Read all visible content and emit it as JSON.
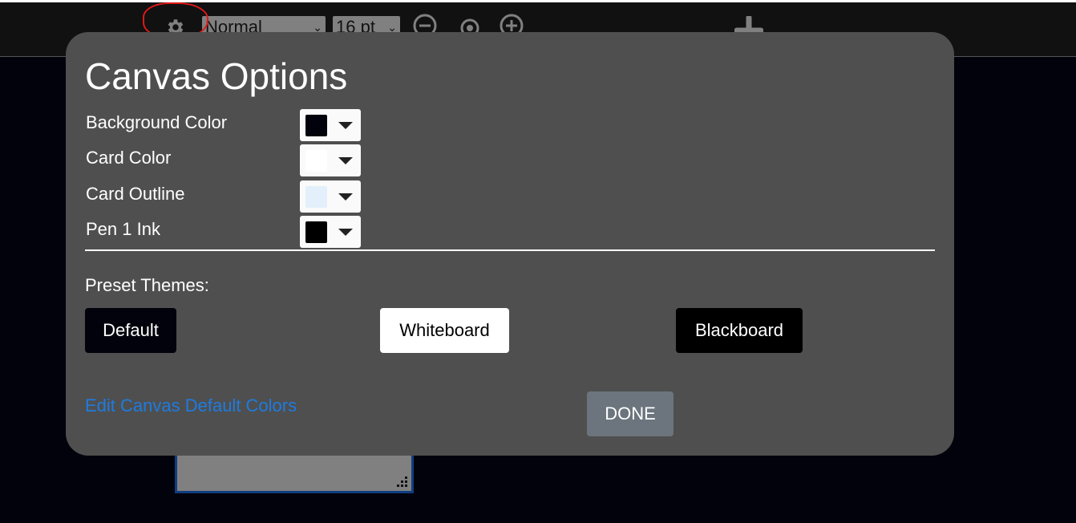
{
  "toolbar": {
    "style_select": {
      "value": "Normal"
    },
    "size_select": {
      "value": "16 pt"
    },
    "icons": [
      "gear-icon",
      "zoom-out-icon",
      "zoom-reset-icon",
      "zoom-in-icon",
      "add-card-icon"
    ],
    "annotation_color": "#e01818"
  },
  "modal": {
    "title": "Canvas Options",
    "color_rows": [
      {
        "label": "Background Color",
        "color": "#02020c"
      },
      {
        "label": "Card Color",
        "color": "#ffffff"
      },
      {
        "label": "Card Outline",
        "color": "#e3f0fb"
      },
      {
        "label": "Pen 1 Ink",
        "color": "#000000"
      }
    ],
    "preset_label": "Preset Themes:",
    "presets": [
      {
        "label": "Default",
        "bg": "#02020c",
        "fg": "#ffffff"
      },
      {
        "label": "Whiteboard",
        "bg": "#ffffff",
        "fg": "#000000"
      },
      {
        "label": "Blackboard",
        "bg": "#000000",
        "fg": "#ffffff"
      }
    ],
    "link_label": "Edit Canvas Default Colors",
    "done_label": "DONE"
  },
  "colors": {
    "modal_bg": "#4f4f4f",
    "link": "#1e7be0",
    "done_bg": "#6c757d",
    "canvas_bg": "#02020c",
    "card_bg": "#808080",
    "card_border": "#0f3e80"
  }
}
